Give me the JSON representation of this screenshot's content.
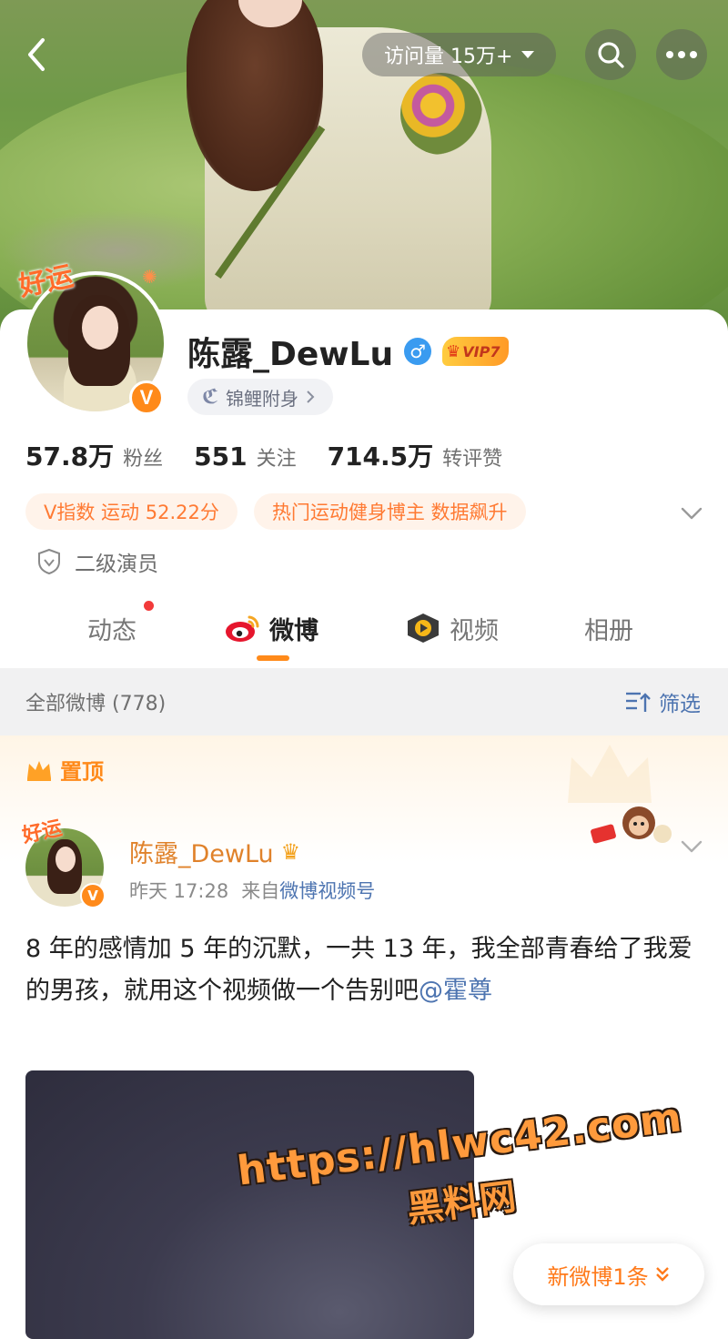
{
  "colors": {
    "accent_orange": "#ff8a1a",
    "link_blue": "#4d74b0",
    "tag_bg": "#fff3ea",
    "tag_text": "#ff7a33"
  },
  "header": {
    "visits_label": "访问量 15万+",
    "back_icon": "back-arrow-icon",
    "search_icon": "search-icon",
    "more_icon": "more-dots-icon"
  },
  "profile": {
    "lucky_tag": "好运",
    "verified_badge": "V",
    "name": "陈露_DewLu",
    "gender_symbol": "♂",
    "vip_label": "VIP7",
    "koi_label": "锦鲤附身",
    "stats": [
      {
        "value": "57.8万",
        "label": "粉丝"
      },
      {
        "value": "551",
        "label": "关注"
      },
      {
        "value": "714.5万",
        "label": "转评赞"
      }
    ],
    "tags": [
      "V指数 运动 52.22分",
      "热门运动健身博主 数据飙升"
    ],
    "role": "二级演员"
  },
  "tabs": [
    {
      "label": "动态",
      "active": false,
      "has_dot": true
    },
    {
      "label": "微博",
      "active": true,
      "icon": "weibo-logo-icon"
    },
    {
      "label": "视频",
      "active": false,
      "icon": "video-play-icon"
    },
    {
      "label": "相册",
      "active": false
    }
  ],
  "filter_bar": {
    "all_label": "全部微博 (778)",
    "filter_label": "筛选"
  },
  "pinned": {
    "label": "置顶",
    "post": {
      "lucky_tag": "好运",
      "verified_badge": "V",
      "author": "陈露_DewLu",
      "time": "昨天 17:28",
      "source_prefix": "来自",
      "source": "微博视频号",
      "text": "8 年的感情加 5 年的沉默，一共 13 年，我全部青春给了我爱的男孩，就用这个视频做一个告别吧",
      "mention": "@霍尊"
    }
  },
  "watermark": {
    "url": "https://hlwc42.com",
    "site": "黑料网"
  },
  "new_post_pill": "新微博1条"
}
